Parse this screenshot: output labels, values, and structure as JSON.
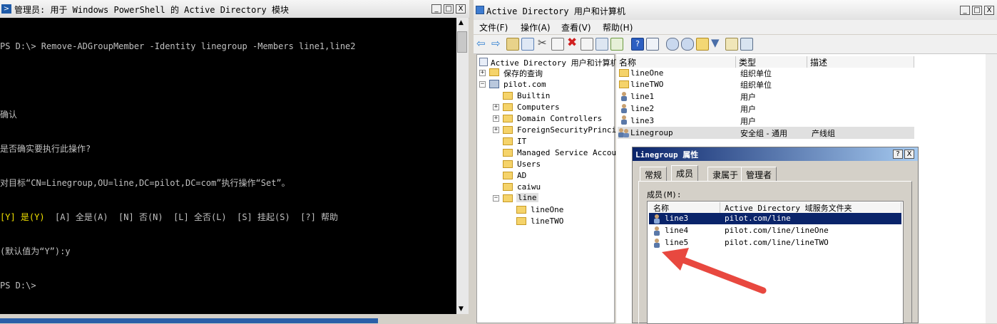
{
  "powershell": {
    "title": "管理员: 用于 Windows PowerShell 的 Active Directory 模块",
    "window_buttons": {
      "minimize": "_",
      "maximize": "□",
      "close": "X"
    },
    "console_lines": [
      "PS D:\\> Remove-ADGroupMember -Identity linegroup -Members line1,line2",
      "",
      "确认",
      "是否确实要执行此操作?",
      "对目标“CN=Linegroup,OU=line,DC=pilot,DC=com”执行操作“Set”。",
      "",
      "(默认值为“Y”):y",
      "PS D:\\>"
    ],
    "prompt_options": {
      "highlight": "[Y] 是(Y)",
      "rest": "  [A] 全是(A)  [N] 否(N)  [L] 全否(L)  [S] 挂起(S)  [?] 帮助"
    }
  },
  "ad": {
    "title": "Active Directory 用户和计算机",
    "window_buttons": {
      "minimize": "_",
      "maximize": "□",
      "close": "X"
    },
    "menu": [
      "文件(F)",
      "操作(A)",
      "查看(V)",
      "帮助(H)"
    ],
    "tree": {
      "root": "Active Directory 用户和计算机",
      "saved_queries": "保存的查询",
      "domain": "pilot.com",
      "children": [
        "Builtin",
        "Computers",
        "Domain Controllers",
        "ForeignSecurityPrincip",
        "IT",
        "Managed Service Accour",
        "Users",
        "AD",
        "caiwu",
        "line"
      ],
      "line_children": [
        "lineOne",
        "lineTWO"
      ]
    },
    "list": {
      "columns": [
        "名称",
        "类型",
        "描述"
      ],
      "rows": [
        {
          "name": "lineOne",
          "type": "组织单位",
          "desc": ""
        },
        {
          "name": "lineTWO",
          "type": "组织单位",
          "desc": ""
        },
        {
          "name": "line1",
          "type": "用户",
          "desc": ""
        },
        {
          "name": "line2",
          "type": "用户",
          "desc": ""
        },
        {
          "name": "line3",
          "type": "用户",
          "desc": ""
        },
        {
          "name": "Linegroup",
          "type": "安全组 - 通用",
          "desc": "产线组"
        }
      ]
    }
  },
  "dialog": {
    "title": "Linegroup 属性",
    "buttons": {
      "help": "?",
      "close": "X"
    },
    "tabs": [
      "常规",
      "成员",
      "隶属于",
      "管理者"
    ],
    "active_tab": "成员",
    "members_label": "成员(M):",
    "columns": [
      "名称",
      "Active Directory 域服务文件夹"
    ],
    "members": [
      {
        "name": "line3",
        "folder": "pilot.com/line"
      },
      {
        "name": "line4",
        "folder": "pilot.com/line/lineOne"
      },
      {
        "name": "line5",
        "folder": "pilot.com/line/lineTWO"
      }
    ]
  },
  "colors": {
    "arrow": "#e8483f",
    "selection": "#0a246a",
    "console_bg": "#000000",
    "console_yellow": "#f0e000"
  }
}
